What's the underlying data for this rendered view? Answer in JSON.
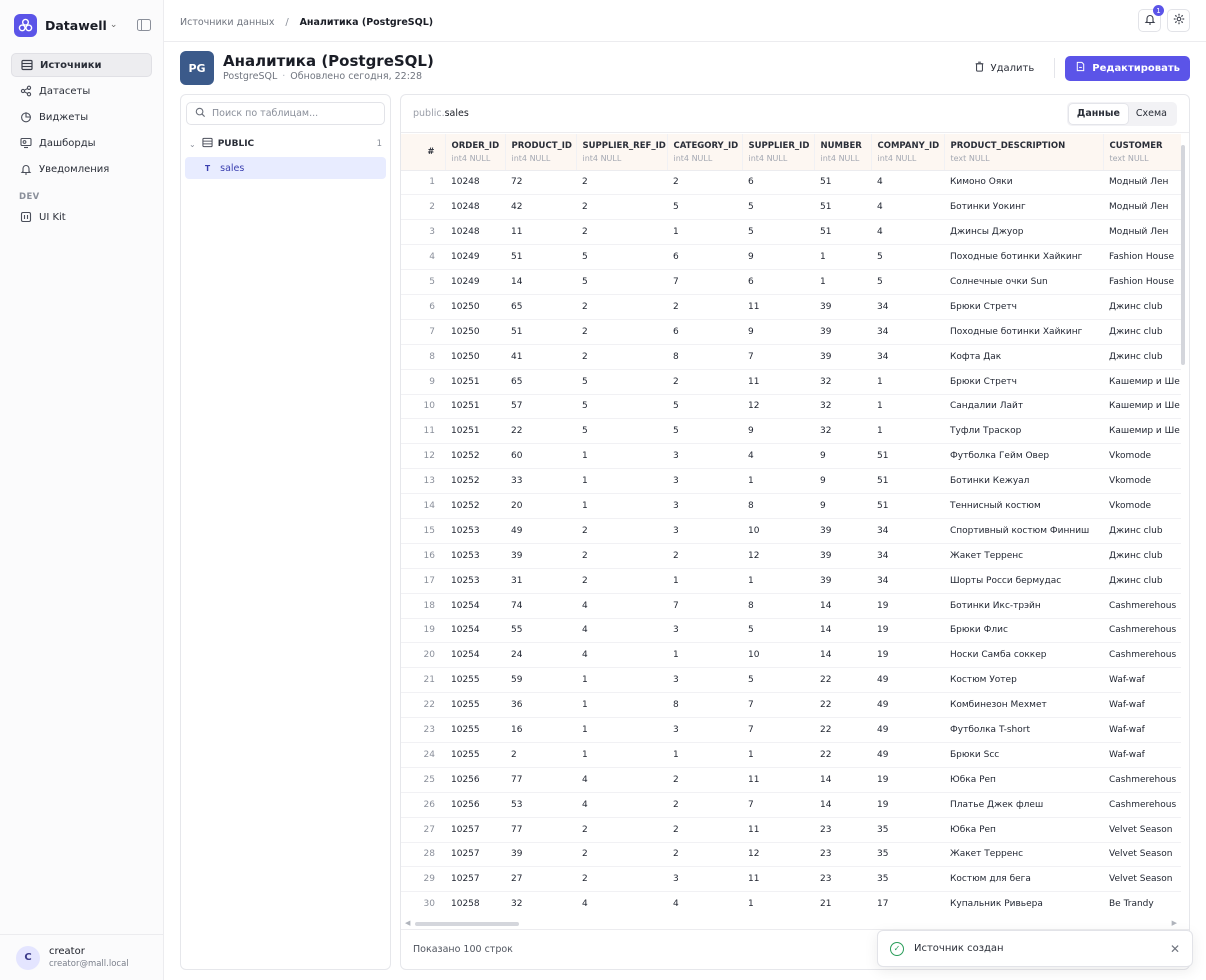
{
  "brand": {
    "name": "Datawell"
  },
  "colors": {
    "accent": "#5b54e8",
    "pg_badge": "#3b5a8a",
    "success": "#2a9d5a"
  },
  "nav": {
    "items": [
      {
        "label": "Источники",
        "icon": "table-icon",
        "active": true
      },
      {
        "label": "Датасеты",
        "icon": "share-nodes-icon",
        "active": false
      },
      {
        "label": "Виджеты",
        "icon": "chart-pie-icon",
        "active": false
      },
      {
        "label": "Дашборды",
        "icon": "dashboard-icon",
        "active": false
      },
      {
        "label": "Уведомления",
        "icon": "bell-icon",
        "active": false
      }
    ],
    "dev_section": "DEV",
    "dev_items": [
      {
        "label": "UI Kit",
        "icon": "ui-kit-icon"
      }
    ]
  },
  "user": {
    "initial": "C",
    "name": "creator",
    "email": "creator@mall.local"
  },
  "breadcrumb": {
    "root": "Источники данных",
    "separator": "/",
    "current": "Аналитика (PostgreSQL)"
  },
  "notifications": {
    "count": "1"
  },
  "source": {
    "badge": "PG",
    "title": "Аналитика (PostgreSQL)",
    "type": "PostgreSQL",
    "updated": "Обновлено сегодня, 22:28",
    "delete_label": "Удалить",
    "edit_label": "Редактировать"
  },
  "tree": {
    "search_placeholder": "Поиск по таблицам...",
    "schema": {
      "name": "PUBLIC",
      "count": "1"
    },
    "tables": [
      {
        "type": "T",
        "name": "sales"
      }
    ]
  },
  "data_view": {
    "schema": "public.",
    "table": "sales",
    "tabs": [
      {
        "label": "Данные",
        "active": true
      },
      {
        "label": "Схема",
        "active": false
      }
    ],
    "footer": "Показано 100 строк",
    "columns": [
      {
        "name": "#",
        "type": ""
      },
      {
        "name": "ORDER_ID",
        "type": "int4 NULL"
      },
      {
        "name": "PRODUCT_ID",
        "type": "int4 NULL"
      },
      {
        "name": "SUPPLIER_REF_ID",
        "type": "int4 NULL"
      },
      {
        "name": "CATEGORY_ID",
        "type": "int4 NULL"
      },
      {
        "name": "SUPPLIER_ID",
        "type": "int4 NULL"
      },
      {
        "name": "NUMBER",
        "type": "int4 NULL"
      },
      {
        "name": "COMPANY_ID",
        "type": "int4 NULL"
      },
      {
        "name": "PRODUCT_DESCRIPTION",
        "type": "text NULL"
      },
      {
        "name": "CUSTOMER",
        "type": "text NULL"
      }
    ],
    "rows": [
      [
        "1",
        "10248",
        "72",
        "2",
        "2",
        "6",
        "51",
        "4",
        "Кимоно Ояки",
        "Модный Лен"
      ],
      [
        "2",
        "10248",
        "42",
        "2",
        "5",
        "5",
        "51",
        "4",
        "Ботинки Уокинг",
        "Модный Лен"
      ],
      [
        "3",
        "10248",
        "11",
        "2",
        "1",
        "5",
        "51",
        "4",
        "Джинсы Джуор",
        "Модный Лен"
      ],
      [
        "4",
        "10249",
        "51",
        "5",
        "6",
        "9",
        "1",
        "5",
        "Походные ботинки Хайкинг",
        "Fashion House"
      ],
      [
        "5",
        "10249",
        "14",
        "5",
        "7",
        "6",
        "1",
        "5",
        "Солнечные очки Sun",
        "Fashion House"
      ],
      [
        "6",
        "10250",
        "65",
        "2",
        "2",
        "11",
        "39",
        "34",
        "Брюки Стретч",
        "Джинс club"
      ],
      [
        "7",
        "10250",
        "51",
        "2",
        "6",
        "9",
        "39",
        "34",
        "Походные ботинки Хайкинг",
        "Джинс club"
      ],
      [
        "8",
        "10250",
        "41",
        "2",
        "8",
        "7",
        "39",
        "34",
        "Кофта Дак",
        "Джинс club"
      ],
      [
        "9",
        "10251",
        "65",
        "5",
        "2",
        "11",
        "32",
        "1",
        "Брюки Стретч",
        "Кашемир и Ше"
      ],
      [
        "10",
        "10251",
        "57",
        "5",
        "5",
        "12",
        "32",
        "1",
        "Сандалии Лайт",
        "Кашемир и Ше"
      ],
      [
        "11",
        "10251",
        "22",
        "5",
        "5",
        "9",
        "32",
        "1",
        "Туфли Траскор",
        "Кашемир и Ше"
      ],
      [
        "12",
        "10252",
        "60",
        "1",
        "3",
        "4",
        "9",
        "51",
        "Футболка Гейм Овер",
        "Vkomode"
      ],
      [
        "13",
        "10252",
        "33",
        "1",
        "3",
        "1",
        "9",
        "51",
        "Ботинки Кежуал",
        "Vkomode"
      ],
      [
        "14",
        "10252",
        "20",
        "1",
        "3",
        "8",
        "9",
        "51",
        "Теннисный костюм",
        "Vkomode"
      ],
      [
        "15",
        "10253",
        "49",
        "2",
        "3",
        "10",
        "39",
        "34",
        "Спортивный костюм Финниш",
        "Джинс club"
      ],
      [
        "16",
        "10253",
        "39",
        "2",
        "2",
        "12",
        "39",
        "34",
        "Жакет Терренс",
        "Джинс club"
      ],
      [
        "17",
        "10253",
        "31",
        "2",
        "1",
        "1",
        "39",
        "34",
        "Шорты Росси бермудас",
        "Джинс club"
      ],
      [
        "18",
        "10254",
        "74",
        "4",
        "7",
        "8",
        "14",
        "19",
        "Ботинки Икс-трэйн",
        "Cashmerehous"
      ],
      [
        "19",
        "10254",
        "55",
        "4",
        "3",
        "5",
        "14",
        "19",
        "Брюки Флис",
        "Cashmerehous"
      ],
      [
        "20",
        "10254",
        "24",
        "4",
        "1",
        "10",
        "14",
        "19",
        "Носки Самба соккер",
        "Cashmerehous"
      ],
      [
        "21",
        "10255",
        "59",
        "1",
        "3",
        "5",
        "22",
        "49",
        "Костюм Уотер",
        "Waf-waf"
      ],
      [
        "22",
        "10255",
        "36",
        "1",
        "8",
        "7",
        "22",
        "49",
        "Комбинезон Мехмет",
        "Waf-waf"
      ],
      [
        "23",
        "10255",
        "16",
        "1",
        "3",
        "7",
        "22",
        "49",
        "Футболка T-short",
        "Waf-waf"
      ],
      [
        "24",
        "10255",
        "2",
        "1",
        "1",
        "1",
        "22",
        "49",
        "Брюки Scc",
        "Waf-waf"
      ],
      [
        "25",
        "10256",
        "77",
        "4",
        "2",
        "11",
        "14",
        "19",
        "Юбка Реп",
        "Cashmerehous"
      ],
      [
        "26",
        "10256",
        "53",
        "4",
        "2",
        "7",
        "14",
        "19",
        "Платье Джек флеш",
        "Cashmerehous"
      ],
      [
        "27",
        "10257",
        "77",
        "2",
        "2",
        "11",
        "23",
        "35",
        "Юбка Реп",
        "Velvet Season"
      ],
      [
        "28",
        "10257",
        "39",
        "2",
        "2",
        "12",
        "23",
        "35",
        "Жакет Терренс",
        "Velvet Season"
      ],
      [
        "29",
        "10257",
        "27",
        "2",
        "3",
        "11",
        "23",
        "35",
        "Костюм для бега",
        "Velvet Season"
      ],
      [
        "30",
        "10258",
        "32",
        "4",
        "4",
        "1",
        "21",
        "17",
        "Купальник Ривьера",
        "Be Trandy"
      ]
    ]
  },
  "toast": {
    "message": "Источник создан"
  }
}
